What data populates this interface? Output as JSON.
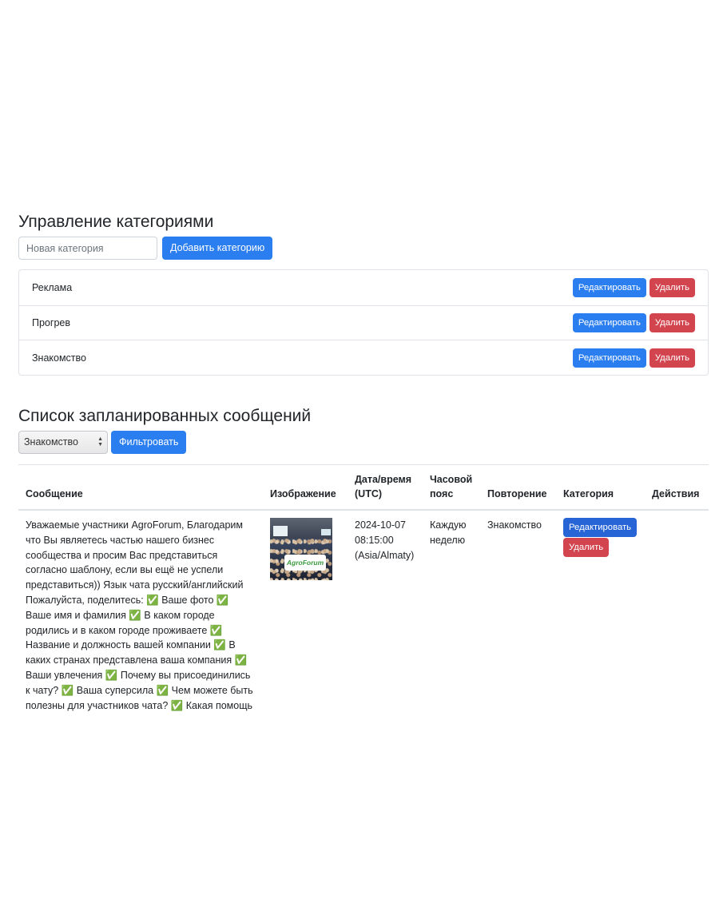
{
  "categories_section": {
    "title": "Управление категориями",
    "new_category_placeholder": "Новая категория",
    "add_button": "Добавить категорию",
    "items": [
      {
        "name": "Реклама",
        "edit": "Редактировать",
        "delete": "Удалить"
      },
      {
        "name": "Прогрев",
        "edit": "Редактировать",
        "delete": "Удалить"
      },
      {
        "name": "Знакомство",
        "edit": "Редактировать",
        "delete": "Удалить"
      }
    ]
  },
  "messages_section": {
    "title": "Список запланированных сообщений",
    "filter_select_value": "Знакомство",
    "filter_button": "Фильтровать",
    "columns": {
      "message": "Сообщение",
      "image": "Изображение",
      "datetime": "Дата/время (UTC)",
      "timezone": "Часовой пояс",
      "repeat": "Повторение",
      "category": "Категория",
      "actions": "Действия"
    },
    "rows": [
      {
        "message": "Уважаемые участники AgroForum, Благодарим что Вы являетесь частью нашего бизнес сообщества и просим Вас представиться согласно шаблону, если вы ещё не успели представиться)) Язык чата русский/английский Пожалуйста, поделитесь: ✅ Ваше фото ✅ Ваше имя и фамилия ✅ В каком городе родились и в каком городе проживаете ✅ Название и должность вашей компании ✅ В каких странах представлена ваша компания ✅ Ваши увлечения ✅ Почему вы присоединились к чату? ✅ Ваша суперсила ✅ Чем можете быть полезны для участников чата? ✅ Какая помощь нужна вам от",
        "image_logo_text": "AgroForum",
        "datetime": "2024-10-07 08:15:00",
        "timezone_note": "(Asia/Almaty)",
        "repeat": "Каждую неделю",
        "category": "Знакомство",
        "edit": "Редактировать",
        "delete": "Удалить"
      }
    ]
  },
  "colors": {
    "primary": "#2b7ef0",
    "danger": "#d2454f",
    "border": "#dfe2e6"
  }
}
